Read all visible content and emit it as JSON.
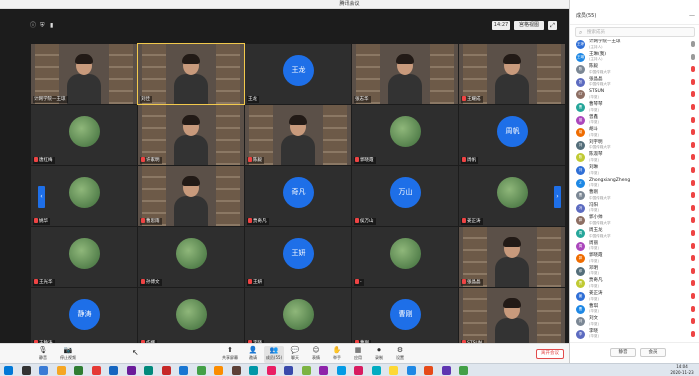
{
  "window": {
    "title": "腾讯会议",
    "controls": [
      "—",
      "□",
      "✕"
    ]
  },
  "infobar": {
    "time": "14:27",
    "view_label": "宫格视图",
    "view_icon": "grid-view-icon",
    "fullscreen_icon": "fullscreen-icon"
  },
  "tiles": [
    {
      "name": "计网学院—王琼",
      "type": "video",
      "muted": false
    },
    {
      "name": "刘佳",
      "type": "video",
      "muted": false,
      "highlight": true
    },
    {
      "name": "王龙",
      "type": "avatar",
      "avatar_text": "王龙",
      "muted": false
    },
    {
      "name": "张志华",
      "type": "video",
      "muted": false
    },
    {
      "name": "王耀成",
      "type": "video",
      "muted": true
    },
    {
      "name": "唐红梅",
      "type": "photo",
      "muted": true
    },
    {
      "name": "许家明",
      "type": "video",
      "muted": true
    },
    {
      "name": "陈毅",
      "type": "video",
      "muted": true
    },
    {
      "name": "郭晓霞",
      "type": "photo",
      "muted": true
    },
    {
      "name": "周帆",
      "type": "avatar",
      "avatar_text": "周帆",
      "muted": true
    },
    {
      "name": "姚华",
      "type": "photo",
      "muted": true
    },
    {
      "name": "曹思雨",
      "type": "video",
      "muted": true
    },
    {
      "name": "贾奇凡",
      "type": "avatar",
      "avatar_text": "奇凡",
      "muted": true
    },
    {
      "name": "侯万山",
      "type": "avatar",
      "avatar_text": "万山",
      "muted": true
    },
    {
      "name": "姜正涛",
      "type": "photo",
      "muted": true
    },
    {
      "name": "王光华",
      "type": "photo",
      "muted": true
    },
    {
      "name": "孙博文",
      "type": "photo",
      "muted": true
    },
    {
      "name": "王妍",
      "type": "avatar",
      "avatar_text": "王妍",
      "muted": true
    },
    {
      "name": "-",
      "type": "photo",
      "muted": true
    },
    {
      "name": "张晶晶",
      "type": "video",
      "muted": true
    },
    {
      "name": "王静涛",
      "type": "avatar",
      "avatar_text": "静涛",
      "muted": true
    },
    {
      "name": "作娜",
      "type": "photo",
      "muted": true
    },
    {
      "name": "李晓",
      "type": "photo",
      "muted": true
    },
    {
      "name": "曹刚",
      "type": "avatar",
      "avatar_text": "曹刚",
      "muted": true
    },
    {
      "name": "STSUN",
      "type": "video",
      "muted": true
    }
  ],
  "nav": {
    "prev": "‹",
    "next": "›"
  },
  "toolbar": {
    "items": [
      {
        "label": "静音",
        "icon": "microphone-icon",
        "glyph": "🎙"
      },
      {
        "label": "停止视频",
        "icon": "camera-icon",
        "glyph": "📷"
      },
      {
        "label": "共享屏幕",
        "icon": "share-screen-icon",
        "glyph": "⬆"
      },
      {
        "label": "邀请",
        "icon": "invite-icon",
        "glyph": "👤"
      },
      {
        "label": "成员(55)",
        "icon": "members-icon",
        "glyph": "👥"
      },
      {
        "label": "聊天",
        "icon": "chat-icon",
        "glyph": "💬"
      },
      {
        "label": "表情",
        "icon": "emoji-icon",
        "glyph": "☺"
      },
      {
        "label": "举手",
        "icon": "raise-hand-icon",
        "glyph": "✋"
      },
      {
        "label": "应用",
        "icon": "apps-icon",
        "glyph": "▦"
      },
      {
        "label": "录制",
        "icon": "record-icon",
        "glyph": "⏺"
      },
      {
        "label": "设置",
        "icon": "settings-icon",
        "glyph": "⚙"
      }
    ],
    "leave_label": "离开会议"
  },
  "panel": {
    "title": "成员(55)",
    "collapse": "—",
    "search_placeholder": "搜索成员",
    "members": [
      {
        "name": "计网学院—王琼",
        "sub": "(主持人)",
        "avatar": "王琼"
      },
      {
        "name": "王琳(我)",
        "sub": "(主持人)",
        "avatar": "王琳"
      },
      {
        "name": "陈毅",
        "sub": "中国传媒大学",
        "avatar": "陈"
      },
      {
        "name": "张晶晶",
        "sub": "中国传媒大学",
        "avatar": "张"
      },
      {
        "name": "STSUN",
        "sub": "(华夏)",
        "avatar": "ST"
      },
      {
        "name": "曹琴琴",
        "sub": "(华夏)",
        "avatar": "曹"
      },
      {
        "name": "曾鑫",
        "sub": "(华夏)",
        "avatar": "曾"
      },
      {
        "name": "胡斗",
        "sub": "(华夏)",
        "avatar": "胡"
      },
      {
        "name": "刘宇明",
        "sub": "中国传媒大学",
        "avatar": "刘"
      },
      {
        "name": "陈淑琴",
        "sub": "(华夏)",
        "avatar": "陈"
      },
      {
        "name": "刘琳",
        "sub": "(华夏)",
        "avatar": "刘"
      },
      {
        "name": "ZhongxiangZheng",
        "sub": "(华夏)",
        "avatar": "Z"
      },
      {
        "name": "曹刚",
        "sub": "中国传媒大学",
        "avatar": "曹"
      },
      {
        "name": "冯阳",
        "sub": "(华夏)",
        "avatar": "冯"
      },
      {
        "name": "郭小帅",
        "sub": "中国传媒大学",
        "avatar": "郭"
      },
      {
        "name": "周玉龙",
        "sub": "中国传媒大学",
        "avatar": "周"
      },
      {
        "name": "周丽",
        "sub": "(华夏)",
        "avatar": "周"
      },
      {
        "name": "郭晓霞",
        "sub": "(华夏)",
        "avatar": "郭"
      },
      {
        "name": "邓明",
        "sub": "(华夏)",
        "avatar": "邓"
      },
      {
        "name": "贾奇凡",
        "sub": "(华夏)",
        "avatar": "贾"
      },
      {
        "name": "姜正涛",
        "sub": "(华夏)",
        "avatar": "姜"
      },
      {
        "name": "曹琪",
        "sub": "(华夏)",
        "avatar": "曹"
      },
      {
        "name": "刘文",
        "sub": "(华夏)",
        "avatar": "刘"
      },
      {
        "name": "李晓",
        "sub": "(华夏)",
        "avatar": "李"
      }
    ],
    "mute_all": "静音",
    "unmute_all": "会员"
  },
  "taskbar": {
    "time": "14:04",
    "date": "2020-11-23"
  }
}
